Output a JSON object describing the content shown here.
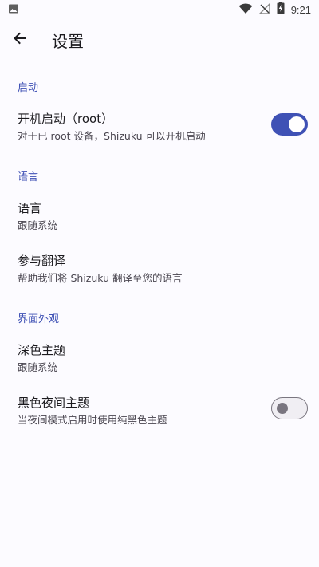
{
  "status_bar": {
    "time": "9:21",
    "icons": [
      "image-icon",
      "wifi-icon",
      "no-signal-icon",
      "battery-charging-icon"
    ]
  },
  "app_bar": {
    "back_icon": "arrow-back-icon",
    "title": "设置"
  },
  "sections": {
    "startup": {
      "header": "启动",
      "boot": {
        "title": "开机启动（root）",
        "summary": "对于已 root 设备，Shizuku 可以开机启动",
        "enabled": true
      }
    },
    "language": {
      "header": "语言",
      "lang": {
        "title": "语言",
        "summary": "跟随系统"
      },
      "translate": {
        "title": "参与翻译",
        "summary": "帮助我们将 Shizuku 翻译至您的语言"
      }
    },
    "appearance": {
      "header": "界面外观",
      "dark_theme": {
        "title": "深色主题",
        "summary": "跟随系统"
      },
      "black_night": {
        "title": "黑色夜间主题",
        "summary": "当夜间模式启用时使用纯黑色主题",
        "enabled": false
      }
    }
  },
  "colors": {
    "accent": "#3f51b5",
    "background": "#fcfbff",
    "text_primary": "#1c1b1f",
    "text_secondary": "#49454f"
  }
}
